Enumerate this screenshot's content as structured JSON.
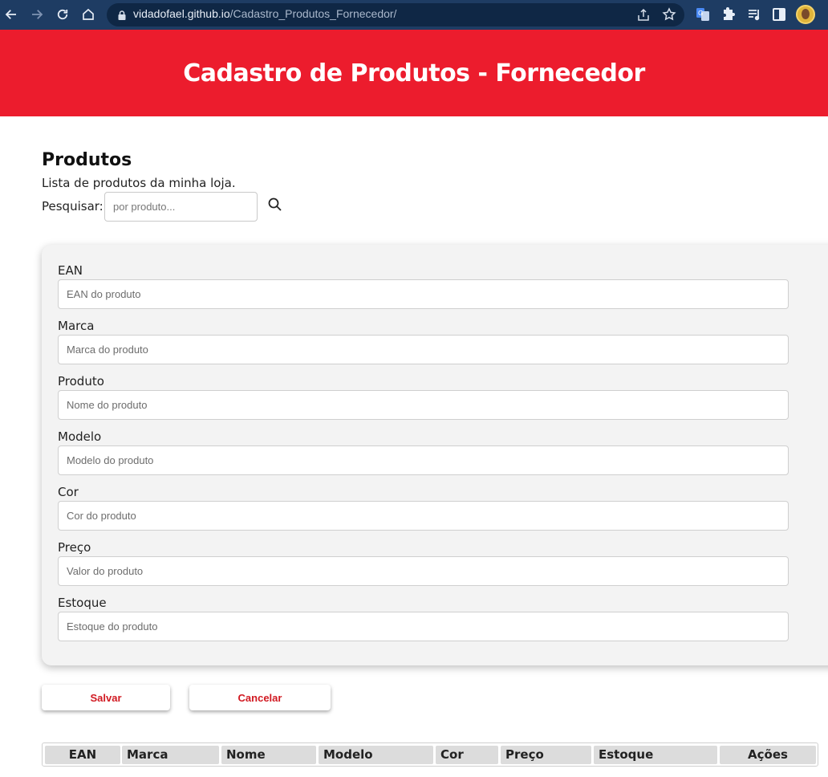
{
  "browser": {
    "url_domain": "vidadofael.github.io",
    "url_path": "/Cadastro_Produtos_Fornecedor/"
  },
  "header": {
    "title": "Cadastro de Produtos - Fornecedor",
    "background_color": "#ec1c2d"
  },
  "products": {
    "title": "Produtos",
    "subtitle": "Lista de produtos da minha loja.",
    "search_label": "Pesquisar:",
    "search_placeholder": "por produto..."
  },
  "form": {
    "fields": [
      {
        "label": "EAN",
        "placeholder": "EAN do produto"
      },
      {
        "label": "Marca",
        "placeholder": "Marca do produto"
      },
      {
        "label": "Produto",
        "placeholder": "Nome do produto"
      },
      {
        "label": "Modelo",
        "placeholder": "Modelo do produto"
      },
      {
        "label": "Cor",
        "placeholder": "Cor do produto"
      },
      {
        "label": "Preço",
        "placeholder": "Valor do produto"
      },
      {
        "label": "Estoque",
        "placeholder": "Estoque do produto"
      }
    ],
    "save_label": "Salvar",
    "cancel_label": "Cancelar",
    "button_text_color": "#d11a22"
  },
  "table": {
    "headers": [
      "EAN",
      "Marca",
      "Nome",
      "Modelo",
      "Cor",
      "Preço",
      "Estoque",
      "Ações"
    ]
  }
}
